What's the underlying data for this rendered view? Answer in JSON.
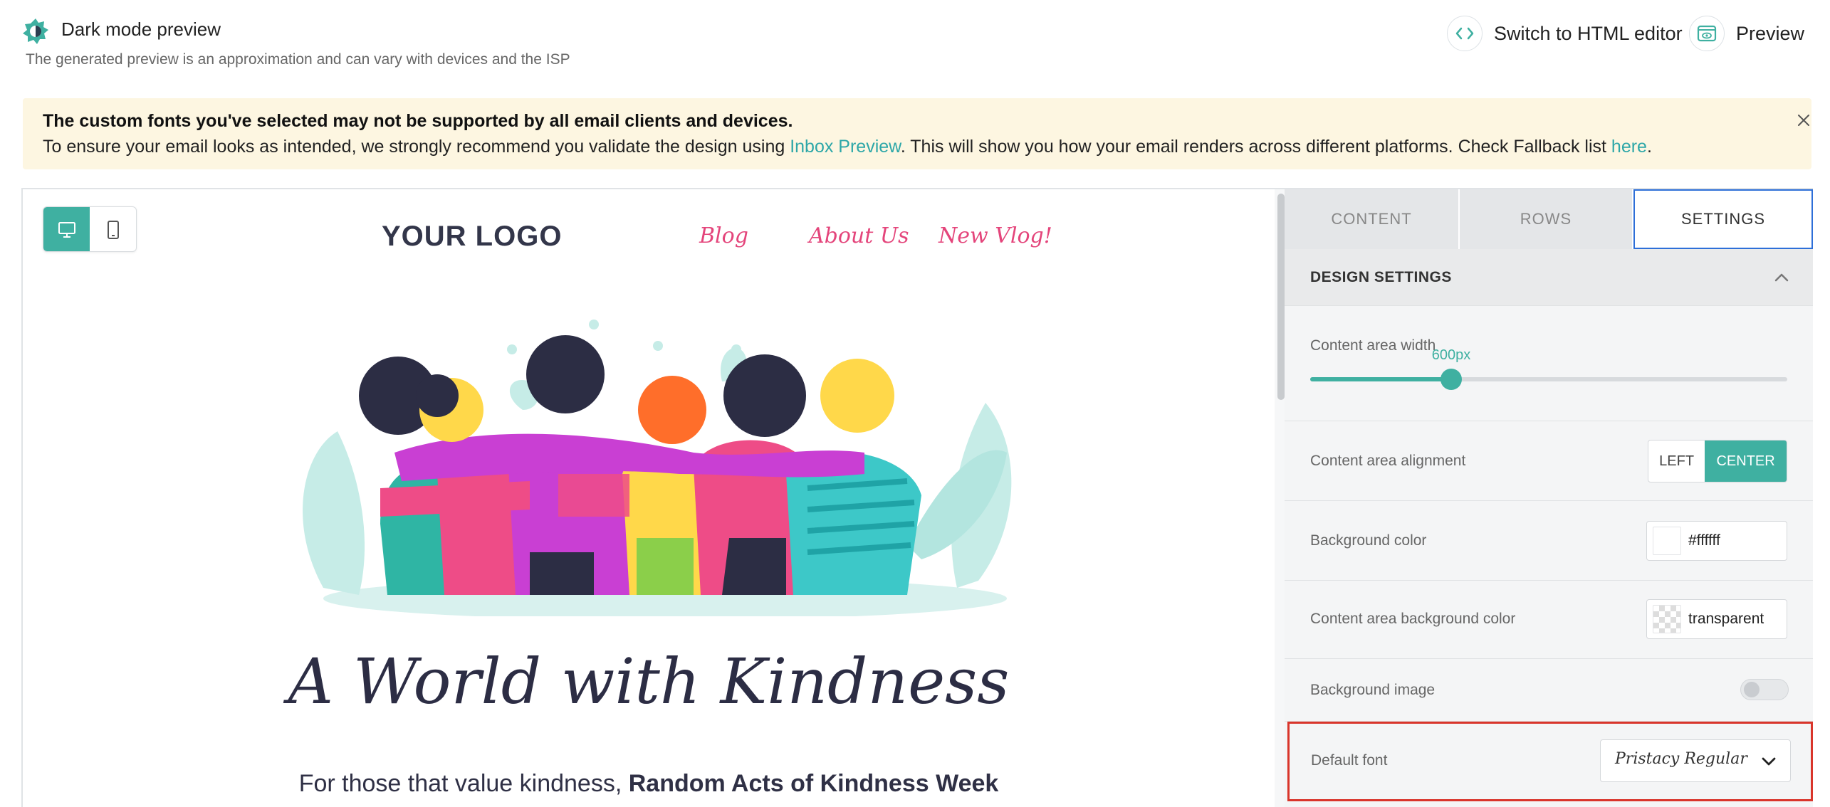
{
  "header": {
    "title": "Dark mode preview",
    "subtitle": "The generated preview is an approximation and can vary with devices and the ISP",
    "html_editor_label": "Switch to HTML editor",
    "preview_label": "Preview"
  },
  "banner": {
    "line1": "The custom fonts you've selected may not be supported by all email clients and devices.",
    "line2_a": "To ensure your email looks as intended, we strongly recommend you validate the design using ",
    "line2_link1": "Inbox Preview",
    "line2_b": ". This will show you how your email renders across different platforms. Check Fallback list ",
    "line2_link2": "here",
    "line2_c": "."
  },
  "email": {
    "logo": "YOUR LOGO",
    "nav": [
      "Blog",
      "About Us",
      "New Vlog!"
    ],
    "headline": "A World with Kindness",
    "subline_a": "For those that value kindness, ",
    "subline_b": "Random Acts of Kindness Week"
  },
  "panel": {
    "tabs": [
      "CONTENT",
      "ROWS",
      "SETTINGS"
    ],
    "active_tab": "SETTINGS",
    "section_title": "DESIGN SETTINGS",
    "content_width_label": "Content area width",
    "content_width_value": "600px",
    "content_width_fraction": 0.296,
    "alignment_label": "Content area alignment",
    "alignment_options": [
      "LEFT",
      "CENTER"
    ],
    "alignment_selected": "CENTER",
    "bg_color_label": "Background color",
    "bg_color_value": "#ffffff",
    "content_bg_label": "Content area background color",
    "content_bg_value": "transparent",
    "bg_image_label": "Background image",
    "bg_image_enabled": false,
    "default_font_label": "Default font",
    "default_font_value": "Pristacy Regular"
  },
  "colors": {
    "accent": "#3fb0a1",
    "link": "#2da7a8",
    "nav_pink": "#e4457b",
    "banner_bg": "#fdf6e1",
    "highlight_red": "#d9352b",
    "active_tab_border": "#2e6fd8"
  }
}
